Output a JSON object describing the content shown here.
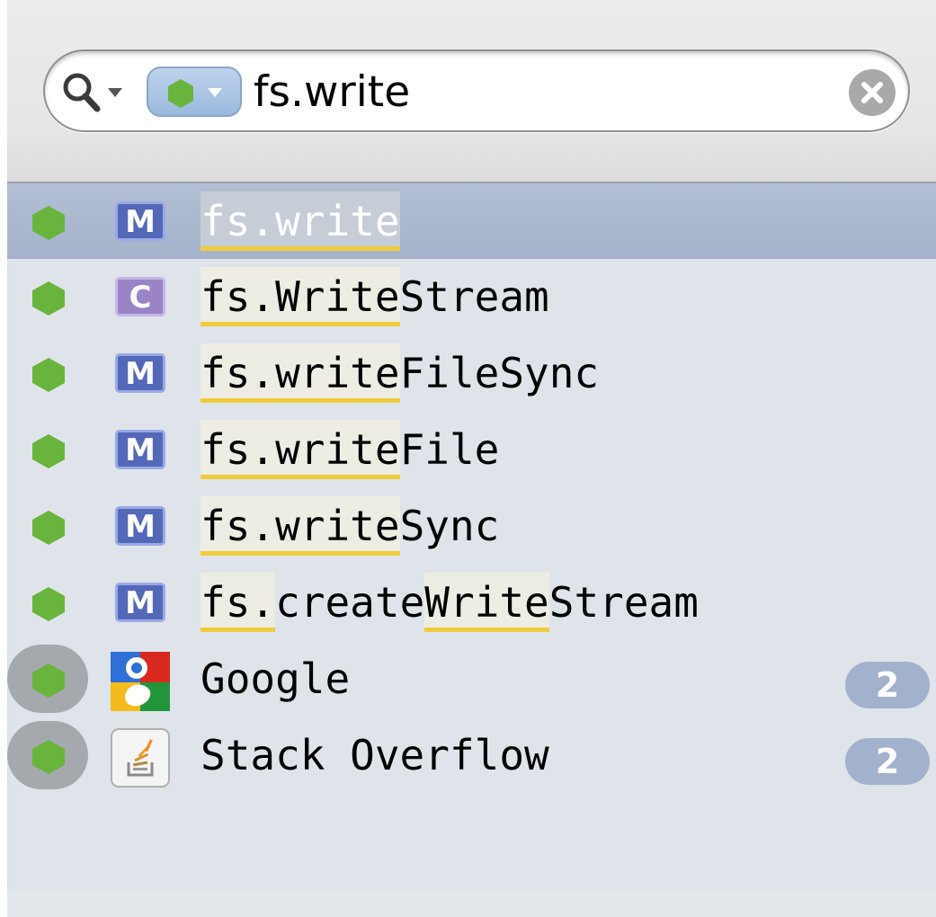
{
  "search": {
    "query": "fs.write",
    "scope_color": "#69b43c"
  },
  "results": [
    {
      "kind": "M",
      "prefix": "",
      "h1": "fs.write",
      "mid": "",
      "h2": "",
      "suffix": "",
      "selected": true
    },
    {
      "kind": "C",
      "prefix": "",
      "h1": "fs.Write",
      "mid": "",
      "h2": "",
      "suffix": "Stream"
    },
    {
      "kind": "M",
      "prefix": "",
      "h1": "fs.write",
      "mid": "",
      "h2": "",
      "suffix": "FileSync"
    },
    {
      "kind": "M",
      "prefix": "",
      "h1": "fs.write",
      "mid": "",
      "h2": "",
      "suffix": "File"
    },
    {
      "kind": "M",
      "prefix": "",
      "h1": "fs.write",
      "mid": "",
      "h2": "",
      "suffix": "Sync"
    },
    {
      "kind": "M",
      "prefix": "",
      "h1": "fs.",
      "mid": "create",
      "h2": "Write",
      "suffix": "Stream"
    }
  ],
  "sources": [
    {
      "name": "Google",
      "count": "2",
      "icon": "google-icon"
    },
    {
      "name": "Stack Overflow",
      "count": "2",
      "icon": "stack-overflow-icon"
    }
  ],
  "colors": {
    "node_green": "#69b43c",
    "method_badge": "#5468b8",
    "class_badge": "#9a84c6",
    "highlight_underline": "#f0cc3c",
    "selection": "#a9b7ce"
  }
}
